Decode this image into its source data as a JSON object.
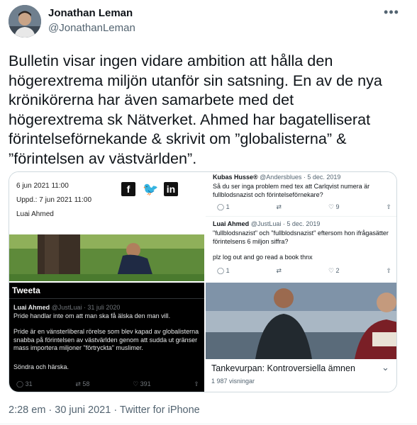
{
  "author": {
    "name": "Jonathan Leman",
    "handle": "@JonathanLeman",
    "avatar_icon": "profile-avatar"
  },
  "more_icon": "more-dots-icon",
  "tweet_text": "Bulletin visar ingen vidare ambition att hålla den\nhögerextrema miljön utanför sin satsning. En av de nya\nkrönikörerna har även samarbete med det\nhögerextrema sk Nätverket. Ahmed har bagatelliserat\nförintelseförnekande & skrivit om ”globalisterna” &\n”förintelsen av västvärlden”.",
  "media": {
    "article": {
      "published": "6 jun 2021 11:00",
      "updated": "Uppd.: 7 jun 2021 11:00",
      "author": "Luai Ahmed",
      "share_icons": [
        "facebook-icon",
        "twitter-icon",
        "linkedin-icon"
      ]
    },
    "thread": {
      "tweet1": {
        "name": "Kubas Husse®",
        "handle": "@Andersblues · 5 dec. 2019",
        "text": "Så du ser inga problem med tex att Carlqvist numera är fullblodsnazist och förintelseförnekare?",
        "replies": "1",
        "likes": "9"
      },
      "tweet2": {
        "name": "Luai Ahmed",
        "handle": "@JustLuai · 5 dec. 2019",
        "text1": "\"fullblodsnazist\" och \"fullblodsnazist\" eftersom hon ifrågasätter förintelsens 6 miljon siffra?",
        "text2": "plz log out and go read a book  thnx",
        "replies": "1",
        "likes": "2"
      }
    },
    "dark_tweet": {
      "header": "Tweeta",
      "name": "Luai Ahmed",
      "handle": "@JustLuai · 31 juli 2020",
      "line1": "Pride handlar inte om att man ska få älska den man vill.",
      "line2": "Pride är en vänsterliberal rörelse som blev kapad av globalisterna snabba på förintelsen av västvärlden genom att sudda ut gränser mass importera miljoner \"förtryckta\" muslimer.",
      "line3": "Söndra och härska.",
      "replies": "31",
      "retweets": "58",
      "likes": "391"
    },
    "video": {
      "title": "Tankevurpan: Kontroversiella ämnen",
      "views": "1 987 visningar"
    }
  },
  "timestamp": "2:28 em · 30 juni 2021 · Twitter for iPhone"
}
